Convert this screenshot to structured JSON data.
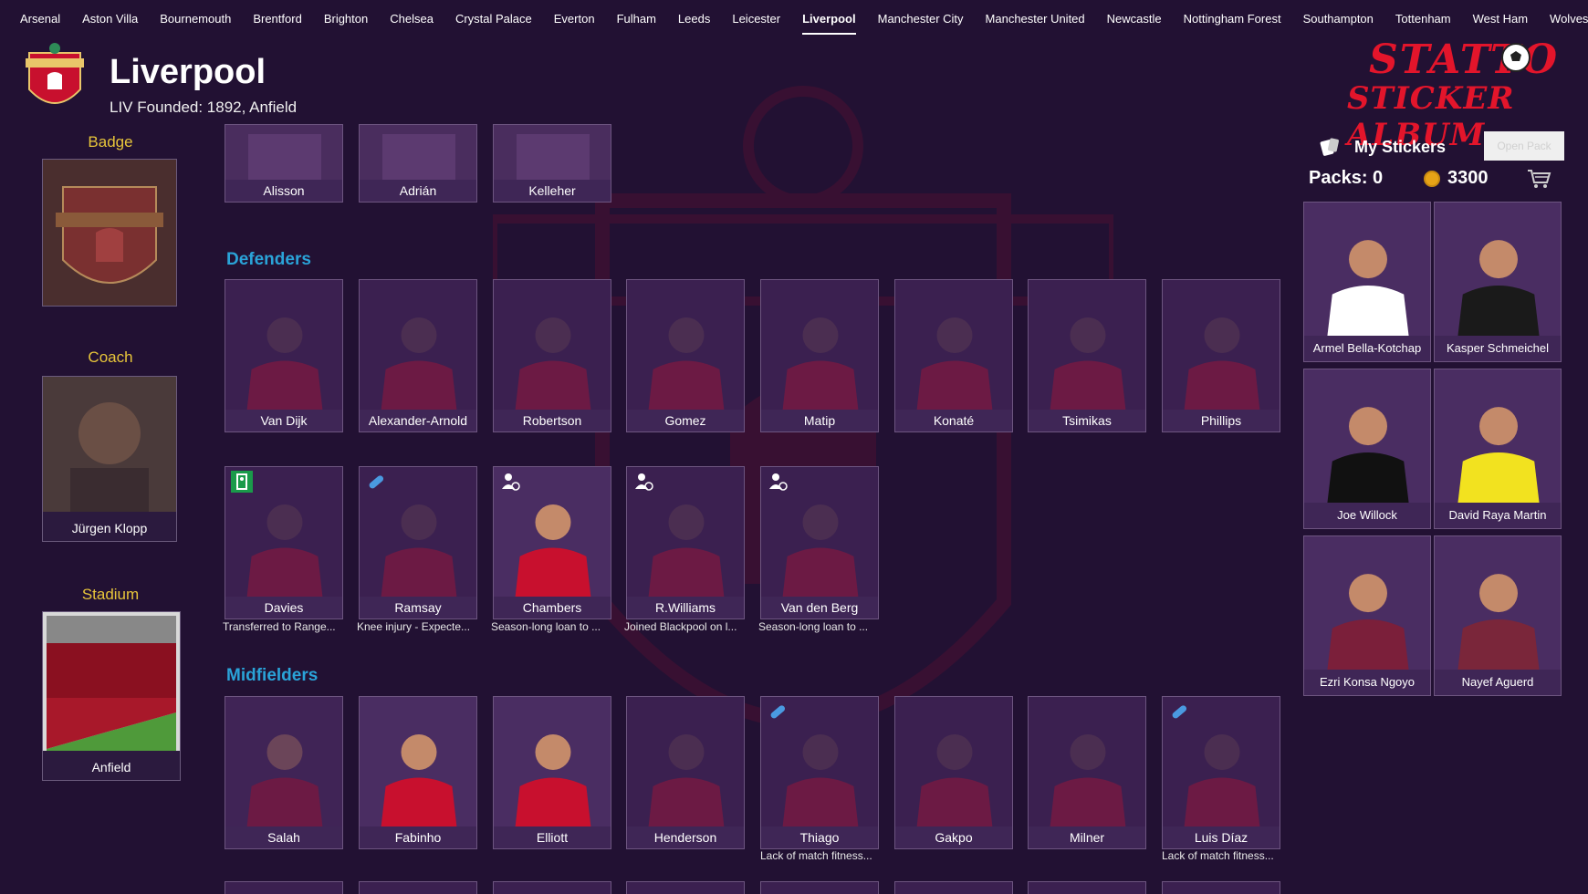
{
  "nav": {
    "tabs": [
      "Arsenal",
      "Aston Villa",
      "Bournemouth",
      "Brentford",
      "Brighton",
      "Chelsea",
      "Crystal Palace",
      "Everton",
      "Fulham",
      "Leeds",
      "Leicester",
      "Liverpool",
      "Manchester City",
      "Manchester United",
      "Newcastle",
      "Nottingham Forest",
      "Southampton",
      "Tottenham",
      "West Ham",
      "Wolves"
    ],
    "active": "Liverpool"
  },
  "club": {
    "name": "Liverpool",
    "subtitle": "LIV Founded: 1892, Anfield",
    "colors": {
      "background": "#221133",
      "section": "#2aa3d8",
      "label": "#e7c53a",
      "kit": "#c8102e"
    }
  },
  "sidebar": {
    "badge_label": "Badge",
    "coach_label": "Coach",
    "coach_name": "Jürgen Klopp",
    "stadium_label": "Stadium",
    "stadium_name": "Anfield"
  },
  "goalkeepers": [
    "Alisson",
    "Adrián",
    "Kelleher"
  ],
  "defenders": {
    "title": "Defenders",
    "row1": [
      "Van Dijk",
      "Alexander-Arnold",
      "Robertson",
      "Gomez",
      "Matip",
      "Konaté",
      "Tsimikas",
      "Phillips"
    ],
    "row2": [
      {
        "name": "Davies",
        "note": "Transferred to Range...",
        "icon": "exit-icon"
      },
      {
        "name": "Ramsay",
        "note": "Knee injury - Expecte...",
        "icon": "injury-icon"
      },
      {
        "name": "Chambers",
        "note": "Season-long loan to ...",
        "icon": "loan-icon"
      },
      {
        "name": "R.Williams",
        "note": "Joined Blackpool on l...",
        "icon": "loan-icon"
      },
      {
        "name": "Van den Berg",
        "note": "Season-long loan to ...",
        "icon": "loan-icon"
      }
    ]
  },
  "midfielders": {
    "title": "Midfielders",
    "row1": [
      {
        "name": "Salah",
        "note": ""
      },
      {
        "name": "Fabinho",
        "note": ""
      },
      {
        "name": "Elliott",
        "note": ""
      },
      {
        "name": "Henderson",
        "note": ""
      },
      {
        "name": "Thiago",
        "note": "Lack of match fitness..."
      },
      {
        "name": "Gakpo",
        "note": ""
      },
      {
        "name": "Milner",
        "note": ""
      },
      {
        "name": "Luis Díaz",
        "note": "Lack of match fitness..."
      }
    ]
  },
  "right": {
    "brand_line1": "STATTO",
    "brand_line2": "STICKER ALBUM",
    "my_stickers": "My Stickers",
    "open_pack": "Open Pack",
    "packs": "Packs: 0",
    "coins": "3300",
    "stickers": [
      "Armel Bella-Kotchap",
      "Kasper Schmeichel",
      "Joe Willock",
      "David Raya Martin",
      "Ezri Konsa Ngoyo",
      "Nayef Aguerd"
    ],
    "sticker_kits": [
      "#ffffff",
      "#1a1a1a",
      "#111111",
      "#f2e21f",
      "#7b1f3a",
      "#7a263a"
    ]
  }
}
